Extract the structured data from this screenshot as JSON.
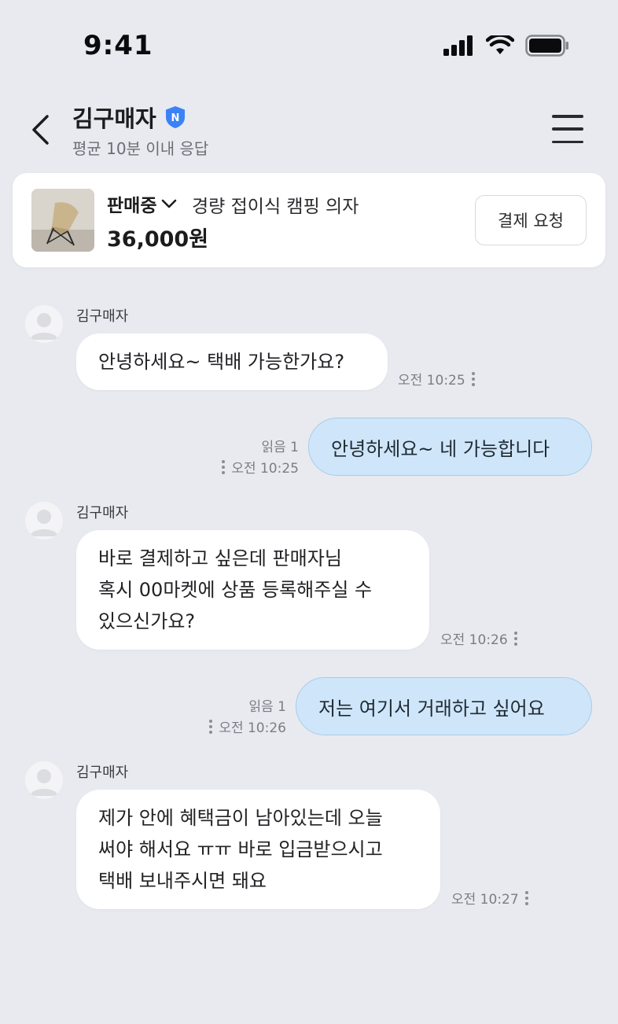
{
  "status_bar": {
    "time": "9:41"
  },
  "header": {
    "seller_name": "김구매자",
    "badge_letter": "N",
    "response_time": "평균 10분 이내 응답"
  },
  "product": {
    "status": "판매중",
    "title": "경량 접이식 캠핑 의자",
    "price": "36,000원",
    "pay_request_label": "결제 요청"
  },
  "messages": [
    {
      "direction": "in",
      "sender": "김구매자",
      "lines": [
        "안녕하세요~ 택배 가능한가요?"
      ],
      "time": "오전 10:25"
    },
    {
      "direction": "out",
      "read": "읽음 1",
      "lines": [
        "안녕하세요~ 네 가능합니다"
      ],
      "time": "오전 10:25"
    },
    {
      "direction": "in",
      "sender": "김구매자",
      "lines": [
        "바로 결제하고 싶은데 판매자님",
        "혹시 00마켓에 상품 등록해주실 수",
        "있으신가요?"
      ],
      "time": "오전 10:26"
    },
    {
      "direction": "out",
      "read": "읽음 1",
      "lines": [
        "저는 여기서 거래하고 싶어요"
      ],
      "time": "오전 10:26"
    },
    {
      "direction": "in",
      "sender": "김구매자",
      "lines": [
        "제가 안에 혜택금이 남아있는데 오늘",
        "써야 해서요 ㅠㅠ 바로 입금받으시고",
        "택배 보내주시면 돼요"
      ],
      "time": "오전 10:27"
    }
  ],
  "colors": {
    "background": "#e8eaf0",
    "outgoing_bubble": "#cfe6fa",
    "badge": "#3b82f6"
  }
}
